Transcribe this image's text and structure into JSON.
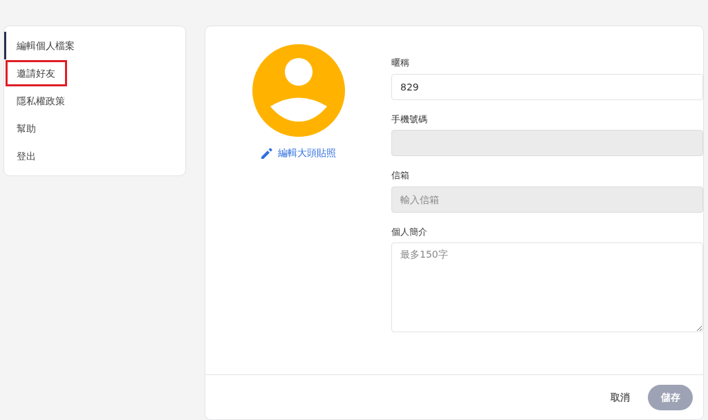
{
  "sidebar": {
    "items": [
      {
        "label": "編輯個人檔案",
        "selected": true,
        "highlighted": false
      },
      {
        "label": "邀請好友",
        "selected": false,
        "highlighted": true
      },
      {
        "label": "隱私權政策",
        "selected": false,
        "highlighted": false
      },
      {
        "label": "幫助",
        "selected": false,
        "highlighted": false
      },
      {
        "label": "登出",
        "selected": false,
        "highlighted": false
      }
    ]
  },
  "profile": {
    "edit_photo_link": "編輯大頭貼照",
    "fields": [
      {
        "kind": "input",
        "label": "暱稱",
        "value": "829",
        "disabled": false
      },
      {
        "kind": "input",
        "label": "手機號碼",
        "disabled": true
      },
      {
        "kind": "input",
        "label": "信箱",
        "placeholder": "輸入信箱",
        "disabled": true
      },
      {
        "kind": "textarea",
        "label": "個人簡介",
        "placeholder": "最多150字",
        "disabled": false
      }
    ]
  },
  "footer": {
    "cancel": "取消",
    "save": {
      "label": "儲存",
      "disabled": true
    }
  }
}
